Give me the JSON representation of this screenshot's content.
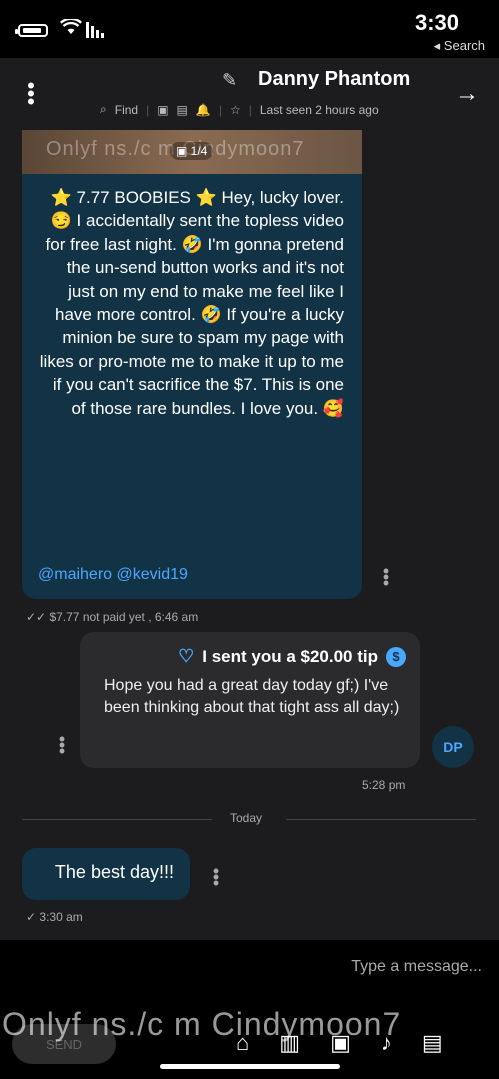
{
  "status_bar": {
    "time": "3:30",
    "back_link": "◂ Search"
  },
  "header": {
    "title": "Danny Phantom",
    "last_seen": "Last seen 2 hours ago",
    "find_label": "Find"
  },
  "chat": {
    "image": {
      "watermark": "Onlyf ns./c m Cindymoon7",
      "count": "1/4"
    },
    "post": {
      "text": "⭐ 7.77 BOOBIES ⭐ Hey, lucky lover. 😏 I accidentally sent the topless video for free last night. 🤣 I'm gonna pretend the un-send button works and it's not just on my end to make me feel like I have more control. 🤣 If you're a lucky minion be sure to spam my page with likes or pro-mote me to make it up to me if you can't sacrifice the $7. This is one of those rare bundles. I love you. 🥰",
      "mentions": "@maihero @kevid19",
      "meta": "$7.77 not paid yet , 6:46 am"
    },
    "tip": {
      "title": "I sent you a $20.00 tip",
      "body": "Hope you had a great day today gf;) I've been thinking about that tight ass all day;)",
      "avatar": "DP",
      "meta": "5:28 pm"
    },
    "divider": "Today",
    "reply": {
      "text": "The best day!!!",
      "meta": "3:30 am"
    }
  },
  "composer": {
    "placeholder": "Type a message...",
    "send_label": "SEND",
    "watermark": "Onlyf ns./c m Cindymoon7"
  },
  "colors": {
    "accent": "#4aa8ff",
    "bubble": "#123345",
    "bg": "#1c1c1e"
  }
}
